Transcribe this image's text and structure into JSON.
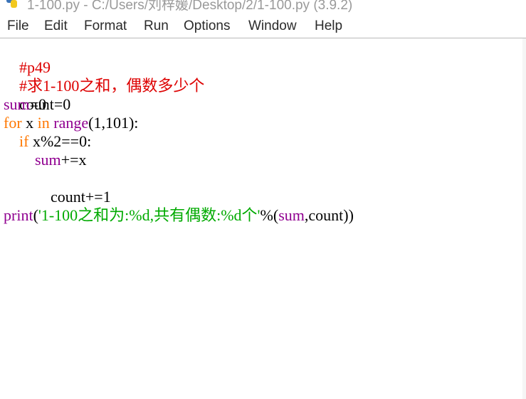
{
  "window": {
    "title": "1-100.py - C:/Users/刘梓媛/Desktop/2/1-100.py (3.9.2)",
    "icon": "python-icon"
  },
  "menu": [
    "File",
    "Edit",
    "Format",
    "Run",
    "Options",
    "Window",
    "Help"
  ],
  "code": {
    "line1": {
      "comment": "#p49"
    },
    "line2": {
      "comment": "#求1-100之和，偶数多少个"
    },
    "line3": {
      "text": "count=0"
    },
    "line4": {
      "builtin": "sum",
      "rest": "=0"
    },
    "line5": {
      "kw1": "for",
      "mid1": " x ",
      "kw2": "in",
      "sp": " ",
      "builtin": "range",
      "rest": "(1,101):"
    },
    "line6": {
      "indent": "    ",
      "kw": "if",
      "rest": " x%2==0:"
    },
    "line7": {
      "indent": "        ",
      "builtin": "sum",
      "rest": "+=x"
    },
    "line8": {
      "text": "        count+=1"
    },
    "line10": {
      "builtin1": "print",
      "open": "(",
      "string": "'1-100之和为:%d,共有偶数:%d个'",
      "mid": "%(",
      "builtin2": "sum",
      "rest": ",count))"
    }
  },
  "colors": {
    "comment": "#dd0000",
    "keyword": "#ff7700",
    "builtin": "#900090",
    "string": "#00aa00"
  }
}
